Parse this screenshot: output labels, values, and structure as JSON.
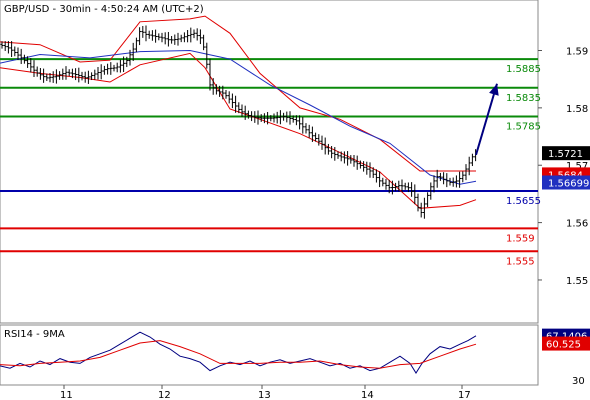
{
  "header": {
    "title": "GBP/USD - 30min - 4:50:24 AM (UTC+2)"
  },
  "colors": {
    "resistance": "#0a8a0a",
    "support_red": "#e00000",
    "pivot": "#0000aa",
    "bollinger": "#e00000",
    "ma": "#2030c0",
    "candles": "#000000",
    "arrow": "#000080",
    "rsi_line": "#000080",
    "rsi_ma": "#e00000"
  },
  "chart_data": [
    {
      "type": "candlestick",
      "title": "GBP/USD - 30min - 4:50:24 AM (UTC+2)",
      "ylim": [
        1.5425,
        1.5988
      ],
      "y_ticks": [
        1.59,
        1.58,
        1.57,
        1.56,
        1.55
      ],
      "x_ticks": [
        "11",
        "12",
        "13",
        "14",
        "17"
      ],
      "price_readout": "1.5721",
      "price_path": [
        [
          0,
          1.591
        ],
        [
          8,
          1.5905
        ],
        [
          16,
          1.5895
        ],
        [
          26,
          1.588
        ],
        [
          36,
          1.5862
        ],
        [
          46,
          1.5852
        ],
        [
          56,
          1.5855
        ],
        [
          66,
          1.5862
        ],
        [
          76,
          1.5858
        ],
        [
          86,
          1.5852
        ],
        [
          96,
          1.586
        ],
        [
          106,
          1.5868
        ],
        [
          116,
          1.587
        ],
        [
          126,
          1.588
        ],
        [
          134,
          1.5905
        ],
        [
          140,
          1.5935
        ],
        [
          146,
          1.5928
        ],
        [
          154,
          1.5925
        ],
        [
          162,
          1.5922
        ],
        [
          170,
          1.5918
        ],
        [
          178,
          1.592
        ],
        [
          186,
          1.5925
        ],
        [
          194,
          1.593
        ],
        [
          202,
          1.592
        ],
        [
          206,
          1.5885
        ],
        [
          210,
          1.584
        ],
        [
          216,
          1.583
        ],
        [
          224,
          1.5825
        ],
        [
          232,
          1.581
        ],
        [
          240,
          1.5795
        ],
        [
          250,
          1.5785
        ],
        [
          260,
          1.5782
        ],
        [
          272,
          1.5782
        ],
        [
          284,
          1.5785
        ],
        [
          296,
          1.5778
        ],
        [
          304,
          1.5765
        ],
        [
          312,
          1.5752
        ],
        [
          320,
          1.574
        ],
        [
          330,
          1.5722
        ],
        [
          340,
          1.5715
        ],
        [
          350,
          1.571
        ],
        [
          360,
          1.57
        ],
        [
          370,
          1.569
        ],
        [
          380,
          1.5672
        ],
        [
          390,
          1.566
        ],
        [
          400,
          1.5665
        ],
        [
          410,
          1.566
        ],
        [
          416,
          1.564
        ],
        [
          420,
          1.5612
        ],
        [
          426,
          1.564
        ],
        [
          432,
          1.5668
        ],
        [
          438,
          1.5682
        ],
        [
          444,
          1.5675
        ],
        [
          450,
          1.567
        ],
        [
          456,
          1.5672
        ],
        [
          462,
          1.568
        ],
        [
          468,
          1.57
        ],
        [
          474,
          1.572
        ],
        [
          478,
          1.5721
        ]
      ],
      "moving_average": [
        [
          0,
          1.5878
        ],
        [
          40,
          1.5893
        ],
        [
          90,
          1.5887
        ],
        [
          140,
          1.5898
        ],
        [
          190,
          1.59
        ],
        [
          230,
          1.5885
        ],
        [
          270,
          1.584
        ],
        [
          310,
          1.5805
        ],
        [
          350,
          1.5768
        ],
        [
          390,
          1.5738
        ],
        [
          430,
          1.5683
        ],
        [
          460,
          1.5667
        ],
        [
          476,
          1.5672
        ]
      ],
      "bollinger_upper": [
        [
          0,
          1.5915
        ],
        [
          40,
          1.591
        ],
        [
          80,
          1.588
        ],
        [
          110,
          1.5883
        ],
        [
          140,
          1.595
        ],
        [
          190,
          1.5955
        ],
        [
          205,
          1.596
        ],
        [
          230,
          1.593
        ],
        [
          260,
          1.586
        ],
        [
          300,
          1.58
        ],
        [
          340,
          1.578
        ],
        [
          380,
          1.5745
        ],
        [
          420,
          1.569
        ],
        [
          460,
          1.569
        ],
        [
          476,
          1.569
        ]
      ],
      "bollinger_lower": [
        [
          0,
          1.587
        ],
        [
          40,
          1.586
        ],
        [
          80,
          1.5853
        ],
        [
          110,
          1.5845
        ],
        [
          140,
          1.5875
        ],
        [
          190,
          1.5895
        ],
        [
          205,
          1.587
        ],
        [
          230,
          1.5798
        ],
        [
          260,
          1.578
        ],
        [
          300,
          1.5755
        ],
        [
          340,
          1.5722
        ],
        [
          380,
          1.5688
        ],
        [
          420,
          1.5625
        ],
        [
          460,
          1.563
        ],
        [
          476,
          1.564
        ]
      ],
      "arrow": {
        "from": [
          476,
          1.5718
        ],
        "to": [
          497,
          1.5842
        ]
      },
      "levels": [
        {
          "label": "1.5885",
          "value": 1.5885,
          "kind": "resistance"
        },
        {
          "label": "1.5835",
          "value": 1.5835,
          "kind": "resistance"
        },
        {
          "label": "1.5785",
          "value": 1.5785,
          "kind": "resistance"
        },
        {
          "label": "1.5655",
          "value": 1.5655,
          "kind": "pivot"
        },
        {
          "label": "1.559",
          "value": 1.559,
          "kind": "support"
        },
        {
          "label": "1.555",
          "value": 1.555,
          "kind": "support"
        }
      ],
      "tags": [
        {
          "label": "1.5684",
          "value": 1.5684,
          "kind": "bollinger"
        },
        {
          "label": "1.56699",
          "value": 1.56699,
          "kind": "ma"
        }
      ]
    },
    {
      "type": "line",
      "title": "RSI14 - 9MA",
      "ylim": [
        26,
        76
      ],
      "y_ticks": [
        70,
        30
      ],
      "readouts": [
        {
          "label": "67.1406",
          "value": 67.1406,
          "kind": "rsi"
        },
        {
          "label": "60.525",
          "value": 60.525,
          "kind": "ma"
        }
      ],
      "series": [
        {
          "key": "rsi",
          "points": [
            [
              0,
              42
            ],
            [
              10,
              40
            ],
            [
              20,
              44
            ],
            [
              30,
              41
            ],
            [
              40,
              46
            ],
            [
              50,
              43
            ],
            [
              60,
              48
            ],
            [
              70,
              45
            ],
            [
              80,
              44
            ],
            [
              90,
              49
            ],
            [
              100,
              52
            ],
            [
              110,
              55
            ],
            [
              120,
              60
            ],
            [
              130,
              65
            ],
            [
              140,
              70
            ],
            [
              150,
              66
            ],
            [
              160,
              60
            ],
            [
              170,
              56
            ],
            [
              180,
              50
            ],
            [
              190,
              48
            ],
            [
              200,
              45
            ],
            [
              210,
              38
            ],
            [
              220,
              42
            ],
            [
              230,
              45
            ],
            [
              240,
              43
            ],
            [
              250,
              46
            ],
            [
              260,
              42
            ],
            [
              270,
              45
            ],
            [
              280,
              47
            ],
            [
              290,
              44
            ],
            [
              300,
              46
            ],
            [
              310,
              48
            ],
            [
              320,
              45
            ],
            [
              330,
              42
            ],
            [
              340,
              44
            ],
            [
              350,
              40
            ],
            [
              360,
              42
            ],
            [
              370,
              38
            ],
            [
              380,
              40
            ],
            [
              390,
              45
            ],
            [
              400,
              50
            ],
            [
              410,
              44
            ],
            [
              416,
              36
            ],
            [
              422,
              44
            ],
            [
              430,
              52
            ],
            [
              440,
              58
            ],
            [
              450,
              56
            ],
            [
              460,
              60
            ],
            [
              468,
              63
            ],
            [
              476,
              67
            ]
          ]
        },
        {
          "key": "ma",
          "points": [
            [
              0,
              43
            ],
            [
              20,
              42
            ],
            [
              40,
              44
            ],
            [
              60,
              45
            ],
            [
              80,
              46
            ],
            [
              100,
              49
            ],
            [
              120,
              55
            ],
            [
              140,
              61
            ],
            [
              160,
              63
            ],
            [
              180,
              58
            ],
            [
              200,
              52
            ],
            [
              220,
              44
            ],
            [
              240,
              44
            ],
            [
              260,
              44
            ],
            [
              280,
              45
            ],
            [
              300,
              45
            ],
            [
              320,
              46
            ],
            [
              340,
              43
            ],
            [
              360,
              41
            ],
            [
              380,
              40
            ],
            [
              400,
              43
            ],
            [
              420,
              44
            ],
            [
              440,
              50
            ],
            [
              460,
              56
            ],
            [
              476,
              60
            ]
          ]
        }
      ]
    }
  ]
}
